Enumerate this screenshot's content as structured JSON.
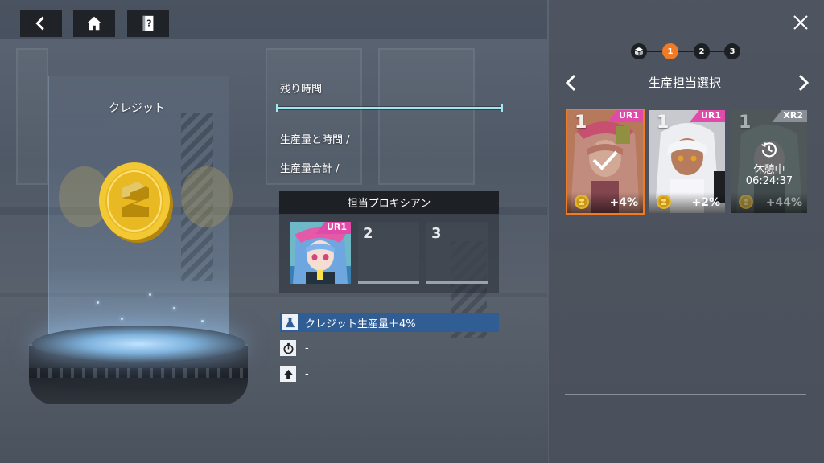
{
  "nav": {
    "back_icon": "chevron-left-icon",
    "home_icon": "home-icon",
    "help_icon": "question-book-icon"
  },
  "resource": {
    "name": "クレジット",
    "icon": "credit-coin-icon"
  },
  "info": {
    "remaining_time_label": "残り時間",
    "remaining_time_progress": 1.0,
    "production_time_label": "生産量と時間 /",
    "production_total_label": "生産量合計 /"
  },
  "assign": {
    "header": "担当プロキシアン",
    "slots": [
      {
        "label": "",
        "rarity": "UR1",
        "filled": true
      },
      {
        "label": "2",
        "filled": false
      },
      {
        "label": "3",
        "filled": false
      }
    ]
  },
  "effects": [
    {
      "icon": "flask-icon",
      "text": "クレジット生産量＋4%",
      "active": true
    },
    {
      "icon": "stopwatch-icon",
      "text": "-",
      "active": false
    },
    {
      "icon": "upgrade-arrow-icon",
      "text": "-",
      "active": false
    }
  ],
  "panel": {
    "title": "生産担当選択",
    "steps": [
      {
        "label": "",
        "icon": "cube-icon",
        "active": false
      },
      {
        "label": "1",
        "active": true
      },
      {
        "label": "2",
        "active": false
      },
      {
        "label": "3",
        "active": false
      }
    ],
    "cards": [
      {
        "level": "1",
        "rarity": "UR1",
        "bonus": "+4%",
        "selected": true,
        "resting": false
      },
      {
        "level": "1",
        "rarity": "UR1",
        "bonus": "+2%",
        "selected": false,
        "resting": false
      },
      {
        "level": "1",
        "rarity": "XR2",
        "bonus": "+44%",
        "selected": false,
        "resting": true,
        "rest_label": "休憩中",
        "rest_time": "06:24:37"
      }
    ]
  },
  "colors": {
    "accent_orange": "#f07b24",
    "rarity_pink": "#e04aa8",
    "progress_cyan": "#9fe8f2",
    "effect_blue": "#2f5d94"
  }
}
